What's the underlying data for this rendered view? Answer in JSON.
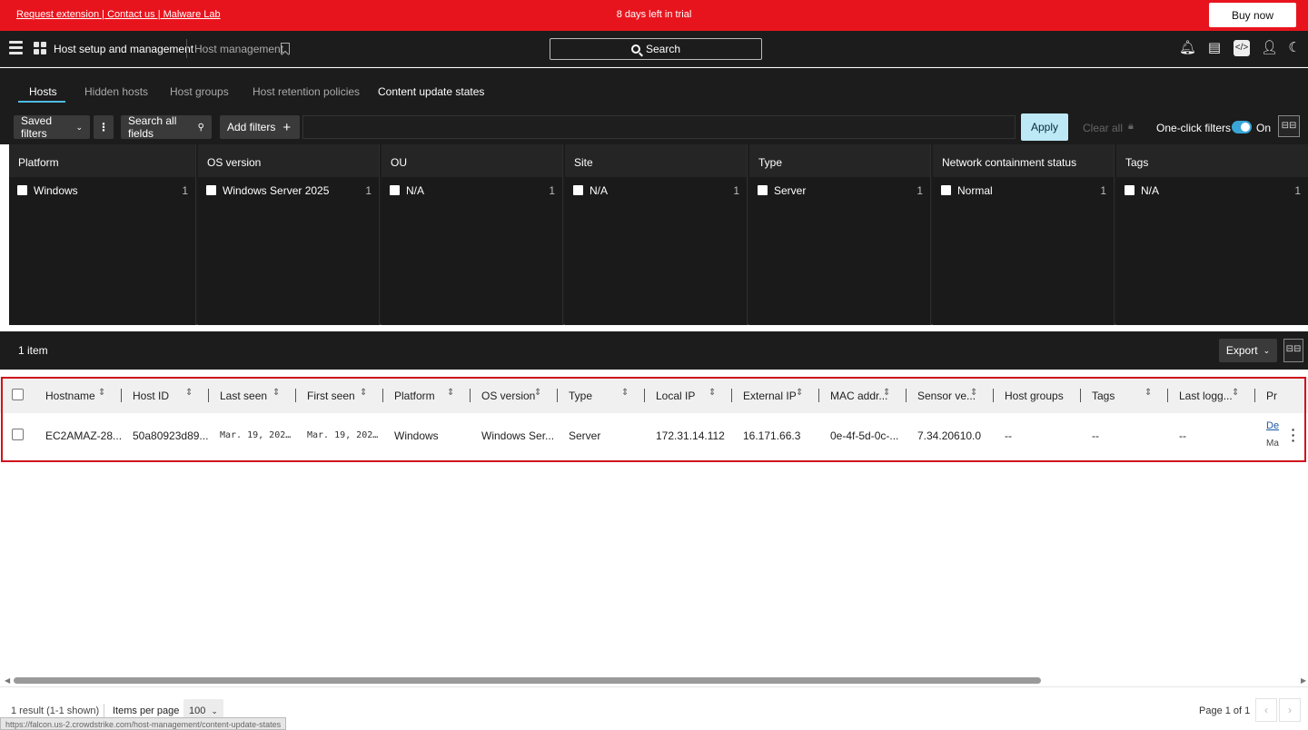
{
  "banner": {
    "links": "Request extension | Contact us | Malware Lab",
    "trial_text": "8 days left in trial",
    "buy_label": "Buy now",
    "color": "#e8141d"
  },
  "topnav": {
    "app_title": "Host setup and management",
    "page_title": "Host management",
    "search_label": "Search",
    "icons": [
      "bell-icon",
      "news-icon",
      "code-icon",
      "user-icon",
      "moon-icon"
    ]
  },
  "tabs": [
    {
      "label": "Hosts",
      "active": true
    },
    {
      "label": "Hidden hosts"
    },
    {
      "label": "Host groups"
    },
    {
      "label": "Host retention policies"
    },
    {
      "label": "Content update states"
    }
  ],
  "filterbar": {
    "saved_filters": "Saved filters",
    "search_all": "Search all fields",
    "add_filters": "Add filters",
    "apply": "Apply",
    "clear_all": "Clear all",
    "one_click": "One-click filters",
    "toggle_state": "On",
    "accent": "#3aa6d7"
  },
  "facets": [
    {
      "title": "Platform",
      "item": "Windows",
      "count": "1"
    },
    {
      "title": "OS version",
      "item": "Windows Server 2025",
      "count": "1"
    },
    {
      "title": "OU",
      "item": "N/A",
      "count": "1"
    },
    {
      "title": "Site",
      "item": "N/A",
      "count": "1"
    },
    {
      "title": "Type",
      "item": "Server",
      "count": "1"
    },
    {
      "title": "Network containment status",
      "item": "Normal",
      "count": "1"
    },
    {
      "title": "Tags",
      "item": "N/A",
      "count": "1"
    }
  ],
  "items_bar": {
    "count": "1 item",
    "export": "Export"
  },
  "table": {
    "columns": [
      "Hostname",
      "Host ID",
      "Last seen",
      "First seen",
      "Platform",
      "OS version",
      "Type",
      "Local IP",
      "External IP",
      "MAC addr...",
      "Sensor ve...",
      "Host groups",
      "Tags",
      "Last logg...",
      "Pr"
    ],
    "row": [
      "EC2AMAZ-28...",
      "50a80923d89...",
      "Mar. 19, 202…",
      "Mar. 19, 202…",
      "Windows",
      "Windows Ser...",
      "Server",
      "172.31.14.112",
      "16.171.66.3",
      "0e-4f-5d-0c-...",
      "7.34.20610.0",
      "--",
      "--",
      "--"
    ],
    "last_col_link": "De",
    "last_col_sub": "Ma"
  },
  "footer": {
    "result": "1 result (1-1 shown)",
    "ipp_label": "Items per page",
    "ipp_value": "100",
    "page": "Page 1 of 1"
  },
  "status_url": "https://falcon.us-2.crowdstrike.com/host-management/content-update-states"
}
